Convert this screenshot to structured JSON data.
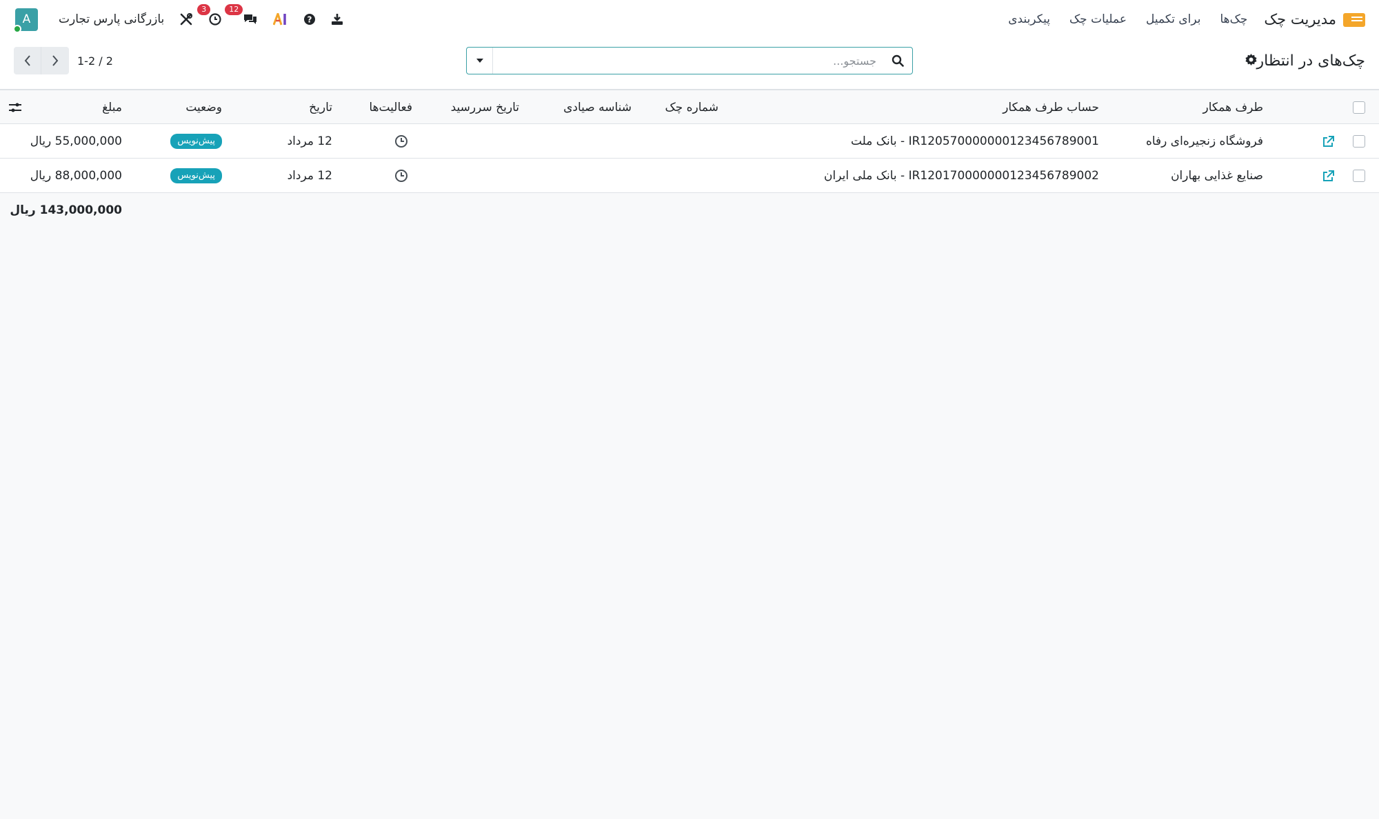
{
  "navbar": {
    "app_title": "مدیریت چک",
    "menu": [
      "چک‌ها",
      "برای تکمیل",
      "عملیات چک",
      "پیکربندی"
    ],
    "company": "بازرگانی پارس تجارت",
    "avatar_letter": "A",
    "activity_count": "3",
    "messages_count": "12",
    "accent": "#3aa0a6",
    "badge_color": "#dc3545"
  },
  "control": {
    "title": "چک‌های در انتظار",
    "search_placeholder": "جستجو...",
    "pager_value": "1-2 / 2"
  },
  "table": {
    "columns": {
      "partner": "طرف همکار",
      "partner_account": "حساب طرف همکار",
      "check_number": "شماره چک",
      "sayad_id": "شناسه صیادی",
      "due_date": "تاریخ سررسید",
      "activities": "فعالیت‌ها",
      "date": "تاریخ",
      "status": "وضعیت",
      "amount": "مبلغ"
    },
    "rows": [
      {
        "partner": "فروشگاه زنجیره‌ای رفاه",
        "partner_account": "IR120570000000123456789001 - بانک ملت",
        "check_number": "",
        "sayad_id": "",
        "due_date": "",
        "date": "12 مرداد",
        "status": "پیش‌نویس",
        "amount": "55,000,000 ریال"
      },
      {
        "partner": "صنایع غذایی بهاران",
        "partner_account": "IR120170000000123456789002 - بانک ملی ایران",
        "check_number": "",
        "sayad_id": "",
        "due_date": "",
        "date": "12 مرداد",
        "status": "پیش‌نویس",
        "amount": "88,000,000 ریال"
      }
    ],
    "total_amount": "143,000,000 ریال"
  }
}
